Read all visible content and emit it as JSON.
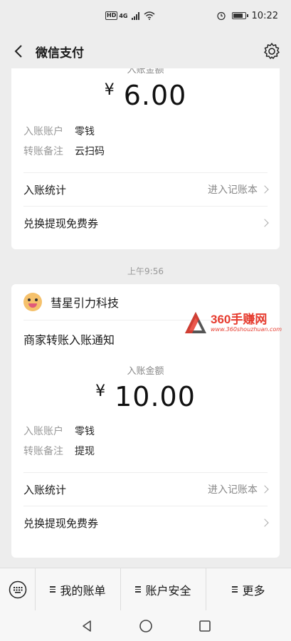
{
  "status_bar": {
    "hd": "HD",
    "network": "4G",
    "time": "10:22",
    "battery_level": 0.85
  },
  "nav": {
    "title": "微信支付"
  },
  "card1": {
    "amount_label": "入账金额",
    "currency": "¥",
    "amount": "6.00",
    "account_key": "入账账户",
    "account_value": "零钱",
    "note_key": "转账备注",
    "note_value": "云扫码",
    "stats_label": "入账统计",
    "stats_link": "进入记账本",
    "coupon_label": "兑换提现免费券"
  },
  "timestamp": "上午9:56",
  "card2": {
    "merchant": "彗星引力科技",
    "notice_title": "商家转账入账通知",
    "amount_label": "入账金额",
    "currency": "¥",
    "amount": "10.00",
    "account_key": "入账账户",
    "account_value": "零钱",
    "note_key": "转账备注",
    "note_value": "提现",
    "stats_label": "入账统计",
    "stats_link": "进入记账本",
    "coupon_label": "兑换提现免费券"
  },
  "watermark": {
    "main": "360手赚网",
    "sub": "www.360shouzhuan.com"
  },
  "bottom_menu": {
    "items": [
      "我的账单",
      "账户安全",
      "更多"
    ]
  },
  "colors": {
    "background": "#ededed",
    "card": "#ffffff",
    "watermark": "#e63b2e"
  }
}
